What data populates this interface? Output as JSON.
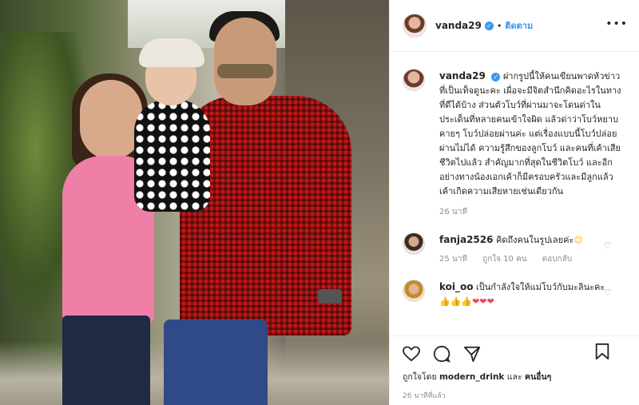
{
  "post": {
    "username": "vanda29",
    "follow_label": "ติดตาม",
    "separator": "•",
    "more_label": "•••"
  },
  "caption": {
    "username": "vanda29",
    "text": "ฝากรูปนี้ให้คนเขียนพาดหัวข่าวที่เป็นเท็จดูนะคะ เผื่อจะมีจิตสำนึกคิดอะไรในทางที่ดีได้บ้าง ส่วนตัวโบว์ที่ผ่านมาจะโดนด่าในประเด็นที่หลายคนเข้าใจผิด แล้วด่าว่าโบว์หยาบคายๆ โบว์ปล่อยผ่านค่ะ แต่เรื่องแบบนี้โบว์ปล่อยผ่านไม่ได้ ความรู้สึกของลูกโบว์ และคนที่เค้าเสียชีวิตไปแล้ว สำคัญมากที่สุดในชีวิตโบว์ และอีกอย่างทางน้องเอกเค้าก็มีครอบครัวและมีลูกแล้ว เค้าเกิดความเสียหายเช่นเดียวกัน",
    "time": "26 นาที"
  },
  "comments": [
    {
      "username": "fanja2526",
      "text": "คิดถึงคนในรูปเลยค่ะ",
      "emoji": "😊",
      "time": "25 นาที",
      "likes": "ถูกใจ 10 คน",
      "reply": "ตอบกลับ"
    },
    {
      "username": "koi_oo",
      "text": "เป็นกำลังใจให้แม่โบว์กับมะลินะคะ",
      "emoji": "👍👍👍❤❤❤",
      "time": "",
      "likes": "",
      "reply": ""
    }
  ],
  "footer": {
    "liked_by_prefix": "ถูกใจโดย",
    "liked_by_user": "modern_drink",
    "liked_by_and": "และ",
    "liked_by_others": "คนอื่นๆ",
    "ago": "26 นาทีที่แล้ว"
  },
  "colors": {
    "accent": "#3897f0",
    "muted": "#8e8e8e",
    "heart": "#ed4956"
  }
}
